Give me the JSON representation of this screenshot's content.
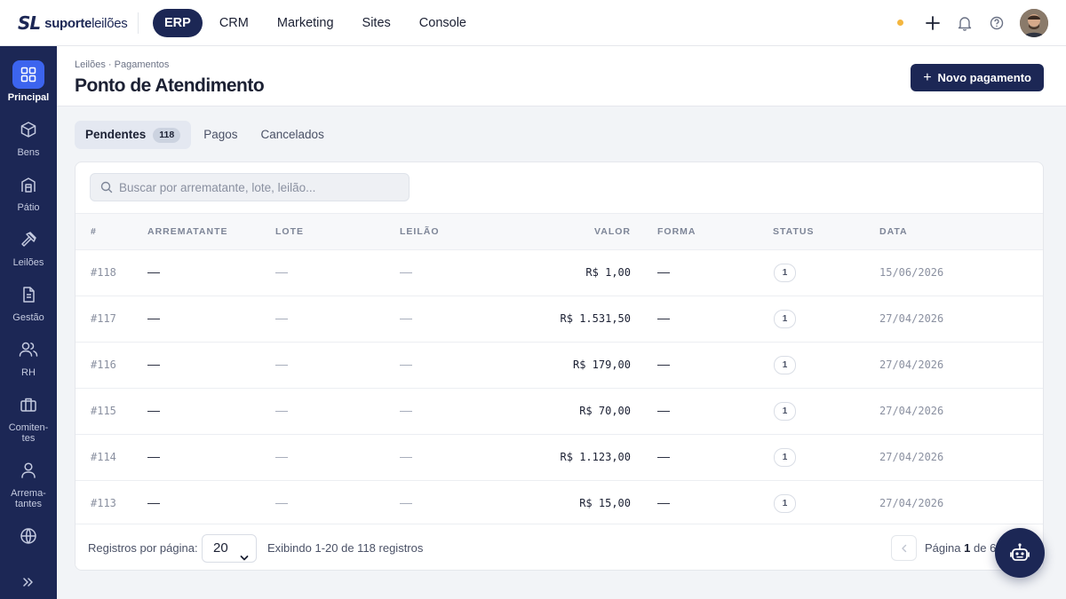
{
  "brand": {
    "mark": "SL",
    "name_bold": "suporte",
    "name_light": "leilões"
  },
  "top_nav": [
    {
      "label": "ERP",
      "active": true
    },
    {
      "label": "CRM",
      "active": false
    },
    {
      "label": "Marketing",
      "active": false
    },
    {
      "label": "Sites",
      "active": false
    },
    {
      "label": "Console",
      "active": false
    }
  ],
  "sidebar": {
    "items": [
      {
        "label": "Principal",
        "icon": "grid-icon",
        "active": true
      },
      {
        "label": "Bens",
        "icon": "box-icon"
      },
      {
        "label": "Pátio",
        "icon": "warehouse-icon"
      },
      {
        "label": "Leilões",
        "icon": "gavel-icon"
      },
      {
        "label": "Gestão",
        "icon": "document-icon"
      },
      {
        "label": "RH",
        "icon": "users-icon"
      },
      {
        "label": "Comiten-tes",
        "line1": "Comiten-",
        "line2": "tes",
        "icon": "briefcase-icon"
      },
      {
        "label": "Arrema-tantes",
        "line1": "Arrema-",
        "line2": "tantes",
        "icon": "user-icon"
      },
      {
        "label": "",
        "icon": "globe-icon"
      }
    ]
  },
  "header": {
    "breadcrumb": "Leilões · Pagamentos",
    "title": "Ponto de Atendimento",
    "new_button": "Novo pagamento"
  },
  "tabs": [
    {
      "label": "Pendentes",
      "count": "118",
      "active": true
    },
    {
      "label": "Pagos"
    },
    {
      "label": "Cancelados"
    }
  ],
  "search": {
    "placeholder": "Buscar por arrematante, lote, leilão...",
    "value": ""
  },
  "table": {
    "columns": [
      "#",
      "ARREMATANTE",
      "LOTE",
      "LEILÃO",
      "VALOR",
      "FORMA",
      "STATUS",
      "DATA"
    ],
    "rows": [
      {
        "id": "#118",
        "arrematante": "—",
        "lote": "—",
        "leilao": "—",
        "valor": "R$ 1,00",
        "forma": "—",
        "status": "1",
        "data": "15/06/2026"
      },
      {
        "id": "#117",
        "arrematante": "—",
        "lote": "—",
        "leilao": "—",
        "valor": "R$ 1.531,50",
        "forma": "—",
        "status": "1",
        "data": "27/04/2026"
      },
      {
        "id": "#116",
        "arrematante": "—",
        "lote": "—",
        "leilao": "—",
        "valor": "R$ 179,00",
        "forma": "—",
        "status": "1",
        "data": "27/04/2026"
      },
      {
        "id": "#115",
        "arrematante": "—",
        "lote": "—",
        "leilao": "—",
        "valor": "R$ 70,00",
        "forma": "—",
        "status": "1",
        "data": "27/04/2026"
      },
      {
        "id": "#114",
        "arrematante": "—",
        "lote": "—",
        "leilao": "—",
        "valor": "R$ 1.123,00",
        "forma": "—",
        "status": "1",
        "data": "27/04/2026"
      },
      {
        "id": "#113",
        "arrematante": "—",
        "lote": "—",
        "leilao": "—",
        "valor": "R$ 15,00",
        "forma": "—",
        "status": "1",
        "data": "27/04/2026"
      }
    ]
  },
  "footer": {
    "per_page_label": "Registros por página:",
    "per_page_value": "20",
    "info": "Exibindo 1-20 de 118 registros",
    "page_prefix": "Página",
    "page_current": "1",
    "page_sep": "de",
    "page_total": "6"
  },
  "colors": {
    "brand_navy": "#1c2755",
    "accent_blue": "#3c64ee",
    "notification_dot": "#f4b63f"
  }
}
